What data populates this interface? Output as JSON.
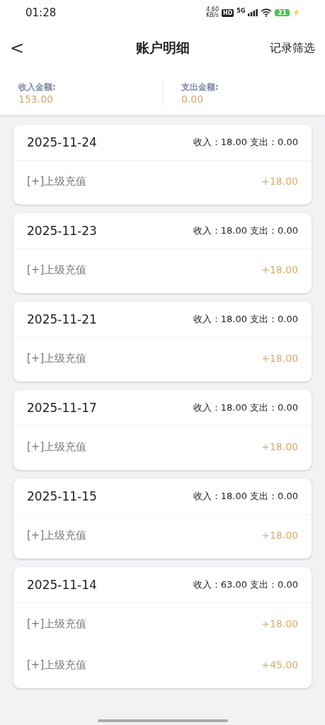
{
  "status_bar": {
    "time": "01:28",
    "net_speed": "4.60",
    "net_unit": "KB/s",
    "hd": "HD",
    "network": "5G",
    "battery": "21"
  },
  "header": {
    "back": "<",
    "title": "账户明细",
    "action": "记录筛选"
  },
  "summary": [
    {
      "label": "收入金额:",
      "value": "153.00"
    },
    {
      "label": "支出金额:",
      "value": "0.00"
    }
  ],
  "days": [
    {
      "date": "2025-11-24",
      "totals": "收入：18.00 支出：0.00",
      "records": [
        {
          "name": "[+]上级充值",
          "amount": "+18.00"
        }
      ]
    },
    {
      "date": "2025-11-23",
      "totals": "收入：18.00 支出：0.00",
      "records": [
        {
          "name": "[+]上级充值",
          "amount": "+18.00"
        }
      ]
    },
    {
      "date": "2025-11-21",
      "totals": "收入：18.00 支出：0.00",
      "records": [
        {
          "name": "[+]上级充值",
          "amount": "+18.00"
        }
      ]
    },
    {
      "date": "2025-11-17",
      "totals": "收入：18.00 支出：0.00",
      "records": [
        {
          "name": "[+]上级充值",
          "amount": "+18.00"
        }
      ]
    },
    {
      "date": "2025-11-15",
      "totals": "收入：18.00 支出：0.00",
      "records": [
        {
          "name": "[+]上级充值",
          "amount": "+18.00"
        }
      ]
    },
    {
      "date": "2025-11-14",
      "totals": "收入：63.00 支出：0.00",
      "records": [
        {
          "name": "[+]上级充值",
          "amount": "+18.00"
        },
        {
          "name": "[+]上级充值",
          "amount": "+45.00"
        }
      ]
    }
  ]
}
